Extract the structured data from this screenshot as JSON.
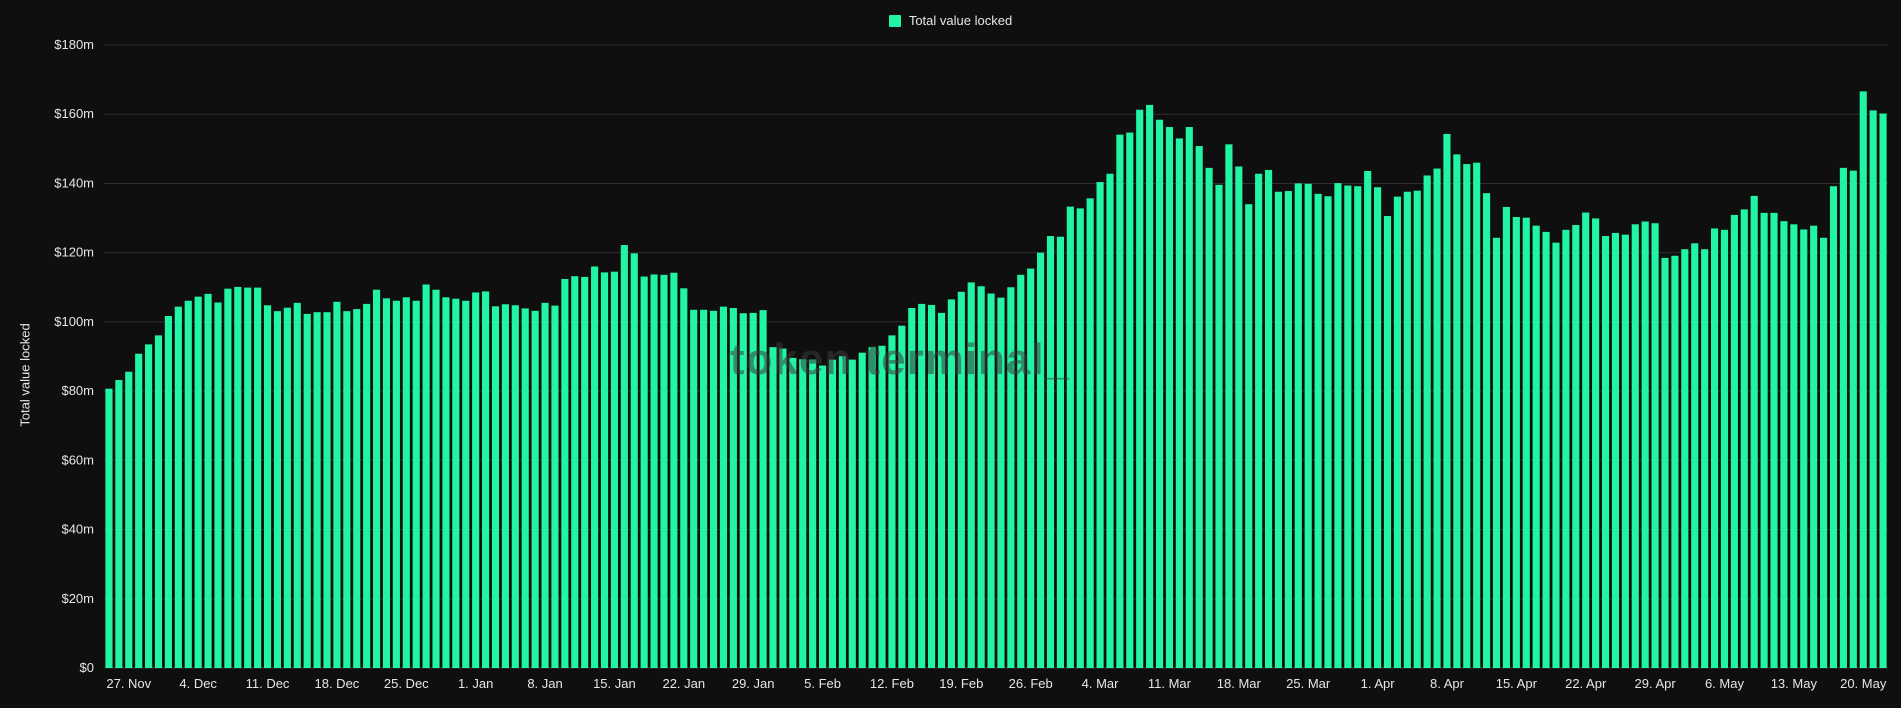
{
  "legend": {
    "label": "Total value locked",
    "color": "#21f5a3"
  },
  "watermark": "token terminal_",
  "chart_data": {
    "type": "bar",
    "title": "",
    "xlabel": "",
    "ylabel": "Total value locked",
    "ylim": [
      0,
      180
    ],
    "y_unit": "$m",
    "y_ticks": [
      "$0",
      "$20m",
      "$40m",
      "$60m",
      "$80m",
      "$100m",
      "$120m",
      "$140m",
      "$160m",
      "$180m"
    ],
    "x_tick_labels": [
      "27. Nov",
      "4. Dec",
      "11. Dec",
      "18. Dec",
      "25. Dec",
      "1. Jan",
      "8. Jan",
      "15. Jan",
      "22. Jan",
      "29. Jan",
      "5. Feb",
      "12. Feb",
      "19. Feb",
      "26. Feb",
      "4. Mar",
      "11. Mar",
      "18. Mar",
      "25. Mar",
      "1. Apr",
      "8. Apr",
      "15. Apr",
      "22. Apr",
      "29. Apr",
      "6. May",
      "13. May",
      "20. May"
    ],
    "grid": true,
    "legend_position": "top-center",
    "series": [
      {
        "name": "Total value locked",
        "color": "#21f5a3",
        "values": [
          80.7,
          83.2,
          85.6,
          90.8,
          93.5,
          96.1,
          101.7,
          104.4,
          106.1,
          107.3,
          108.1,
          105.6,
          109.6,
          110.1,
          109.9,
          109.9,
          104.8,
          103.1,
          104.1,
          105.5,
          102.3,
          102.8,
          102.8,
          105.8,
          103.1,
          103.7,
          105.2,
          109.3,
          106.8,
          106.1,
          107.1,
          106.1,
          110.8,
          109.3,
          107.1,
          106.7,
          106.1,
          108.5,
          108.8,
          104.5,
          105.1,
          104.8,
          103.9,
          103.2,
          105.5,
          104.7,
          112.4,
          113.2,
          113.0,
          116.0,
          114.3,
          114.5,
          122.2,
          119.8,
          113.1,
          113.7,
          113.6,
          114.2,
          109.7,
          103.5,
          103.5,
          103.2,
          104.4,
          104.0,
          102.5,
          102.6,
          103.4,
          92.7,
          92.3,
          89.6,
          89.2,
          89.1,
          87.4,
          89.1,
          90.1,
          89.1,
          91.1,
          92.7,
          93.1,
          96.1,
          98.9,
          104.0,
          105.2,
          104.9,
          102.6,
          106.5,
          108.7,
          111.4,
          110.3,
          108.2,
          107.0,
          110.0,
          113.6,
          115.4,
          120.0,
          124.8,
          124.6,
          133.3,
          132.8,
          135.7,
          140.4,
          142.8,
          154.1,
          154.7,
          161.3,
          162.7,
          158.4,
          156.3,
          153.0,
          156.3,
          150.8,
          144.5,
          139.6,
          151.3,
          144.9,
          134.0,
          142.8,
          143.9,
          137.6,
          137.8,
          140.0,
          139.9,
          137.0,
          136.3,
          140.1,
          139.4,
          139.2,
          143.6,
          138.9,
          130.6,
          136.2,
          137.6,
          137.9,
          142.3,
          144.3,
          154.3,
          148.4,
          145.6,
          146.0,
          137.2,
          124.3,
          133.2,
          130.3,
          130.1,
          127.8,
          126.0,
          122.9,
          126.6,
          128.0,
          131.6,
          129.9,
          124.8,
          125.7,
          125.2,
          128.2,
          129.0,
          128.5,
          118.5,
          119.1,
          121.0,
          122.7,
          121.0,
          127.0,
          126.6,
          130.9,
          132.5,
          136.4,
          131.5,
          131.5,
          129.1,
          128.2,
          126.7,
          127.8,
          124.3,
          139.2,
          144.5,
          143.7,
          166.6,
          161.1,
          160.2
        ]
      }
    ]
  }
}
